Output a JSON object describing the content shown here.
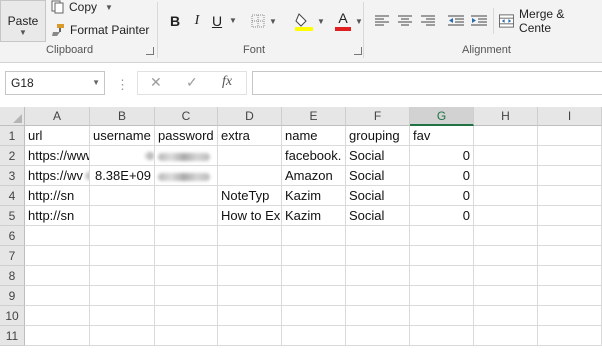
{
  "ribbon": {
    "clipboard": {
      "paste_label": "Paste",
      "copy_label": "Copy",
      "format_painter_label": "Format Painter",
      "group_label": "Clipboard"
    },
    "font": {
      "bold": "B",
      "italic": "I",
      "underline": "U",
      "font_color_letter": "A",
      "group_label": "Font"
    },
    "alignment": {
      "merge_label": "Merge & Cente",
      "group_label": "Alignment"
    },
    "colors": {
      "highlight": "#ffff00",
      "font_color": "#e02020",
      "accent": "#217346"
    }
  },
  "formula_bar": {
    "name_box": "G18",
    "cancel_icon": "✕",
    "enter_icon": "✓",
    "fx_label": "fx",
    "formula": ""
  },
  "sheet": {
    "columns": [
      "A",
      "B",
      "C",
      "D",
      "E",
      "F",
      "G",
      "H",
      "I"
    ],
    "active_column": "G",
    "rows": [
      "1",
      "2",
      "3",
      "4",
      "5",
      "6",
      "7",
      "8",
      "9",
      "10",
      "11"
    ],
    "cells": [
      [
        "url",
        "username",
        "password",
        "extra",
        "name",
        "grouping",
        "fav",
        "",
        ""
      ],
      [
        "https://www.facebo",
        "",
        "",
        "",
        "facebook.",
        "Social",
        "0",
        "",
        ""
      ],
      [
        "https://wv",
        "8.38E+09",
        "",
        "",
        "Amazon",
        "Social",
        "0",
        "",
        ""
      ],
      [
        "http://sn",
        "",
        "",
        "NoteTyp",
        "Kazim",
        "Social",
        "0",
        "",
        ""
      ],
      [
        "http://sn",
        "",
        "",
        "How to Ex",
        "Kazim",
        "Social",
        "0",
        "",
        ""
      ]
    ],
    "redacted": [
      [
        1,
        2
      ],
      [
        2,
        2
      ],
      [
        1,
        1
      ],
      [
        2,
        0
      ]
    ]
  }
}
